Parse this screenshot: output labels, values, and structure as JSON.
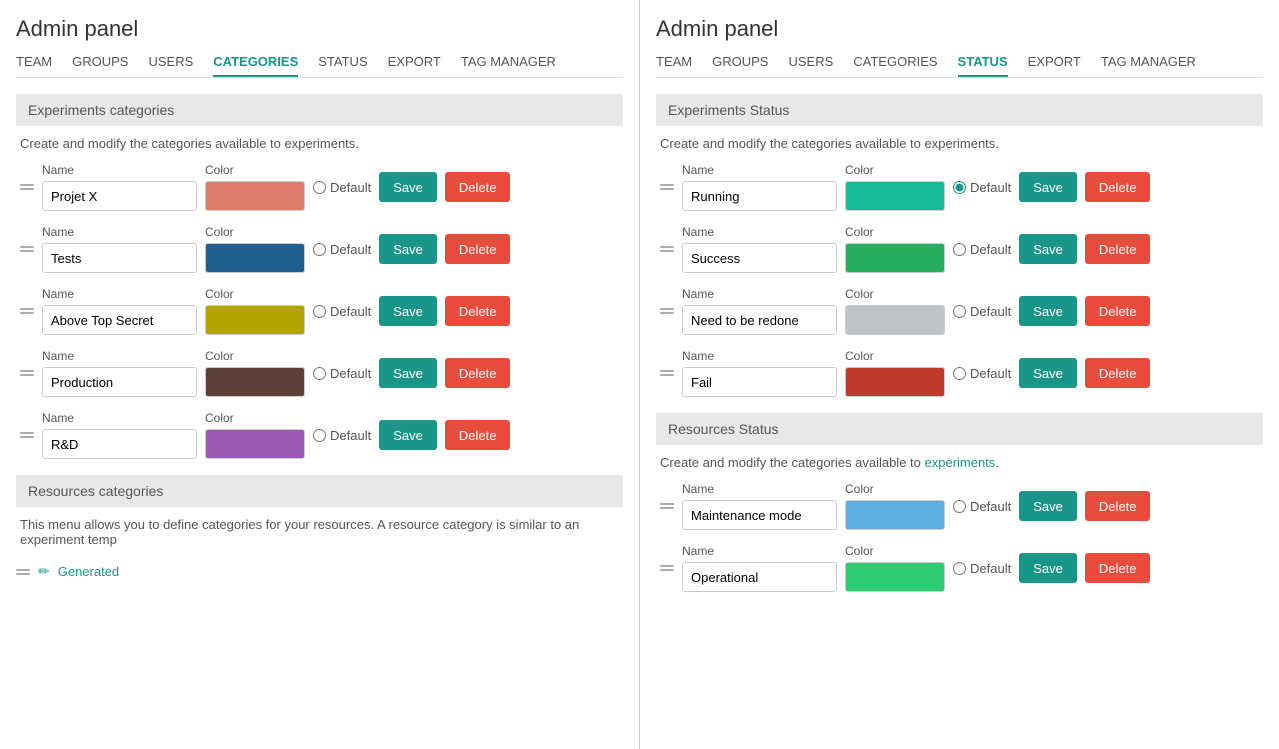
{
  "left_panel": {
    "title": "Admin panel",
    "nav": [
      {
        "label": "TEAM",
        "active": false
      },
      {
        "label": "GROUPS",
        "active": false
      },
      {
        "label": "USERS",
        "active": false
      },
      {
        "label": "CATEGORIES",
        "active": true
      },
      {
        "label": "STATUS",
        "active": false
      },
      {
        "label": "EXPORT",
        "active": false
      },
      {
        "label": "TAG MANAGER",
        "active": false
      }
    ],
    "experiments_section": {
      "header": "Experiments categories",
      "desc": "Create and modify the categories available to experiments.",
      "rows": [
        {
          "name": "Projet X",
          "color": "#e07b6a",
          "default": false
        },
        {
          "name": "Tests",
          "color": "#1f5f8b",
          "default": false
        },
        {
          "name": "Above Top Secret",
          "color": "#b5a300",
          "default": false
        },
        {
          "name": "Production",
          "color": "#5d4037",
          "default": false
        },
        {
          "name": "R&D",
          "color": "#9b59b6",
          "default": false
        }
      ]
    },
    "resources_section": {
      "header": "Resources categories",
      "desc": "This menu allows you to define categories for your resources. A resource category is similar to an experiment temp",
      "items": [
        {
          "label": "Generated",
          "edit": true
        }
      ]
    }
  },
  "right_panel": {
    "title": "Admin panel",
    "nav": [
      {
        "label": "TEAM",
        "active": false
      },
      {
        "label": "GROUPS",
        "active": false
      },
      {
        "label": "USERS",
        "active": false
      },
      {
        "label": "CATEGORIES",
        "active": false
      },
      {
        "label": "STATUS",
        "active": true
      },
      {
        "label": "EXPORT",
        "active": false
      },
      {
        "label": "TAG MANAGER",
        "active": false
      }
    ],
    "experiments_section": {
      "header": "Experiments Status",
      "desc": "Create and modify the categories available to experiments.",
      "rows": [
        {
          "name": "Running",
          "color": "#1abc9c",
          "default": true
        },
        {
          "name": "Success",
          "color": "#27ae60",
          "default": false
        },
        {
          "name": "Need to be redone",
          "color": "#bdc3c7",
          "default": false
        },
        {
          "name": "Fail",
          "color": "#c0392b",
          "default": false
        }
      ]
    },
    "resources_section": {
      "header": "Resources Status",
      "desc_prefix": "Create and modify the categories available to ",
      "desc_link": "experiments",
      "desc_suffix": ".",
      "rows": [
        {
          "name": "Maintenance mode",
          "color": "#5dade2",
          "default": false
        },
        {
          "name": "Operational",
          "color": "#2ecc71",
          "default": false
        }
      ]
    }
  },
  "buttons": {
    "save": "Save",
    "delete": "Delete",
    "default": "Default"
  }
}
